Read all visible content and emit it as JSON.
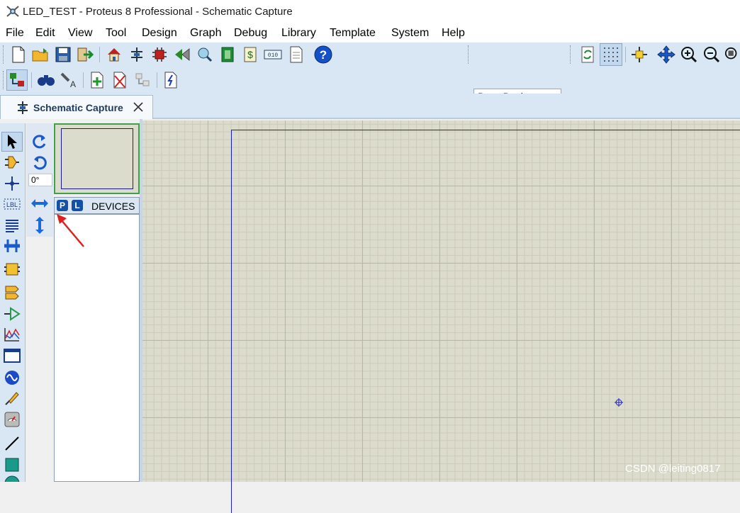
{
  "window": {
    "title": "LED_TEST - Proteus 8 Professional - Schematic Capture"
  },
  "menu": [
    "File",
    "Edit",
    "View",
    "Tool",
    "Design",
    "Graph",
    "Debug",
    "Library",
    "Template",
    "System",
    "Help"
  ],
  "toolbar": {
    "design_select": "Base Design"
  },
  "tab": {
    "label": "Schematic Capture"
  },
  "rotation": {
    "angle": "0°"
  },
  "device_panel": {
    "p_button": "P",
    "l_button": "L",
    "header": "DEVICES"
  },
  "watermark": "CSDN @leiting0817",
  "colors": {
    "sheet_border": "#1e1ec8",
    "canvas_bg": "#dcdccc",
    "toolbar_bg": "#d9e6f3",
    "overview_border": "#3fa24a"
  }
}
